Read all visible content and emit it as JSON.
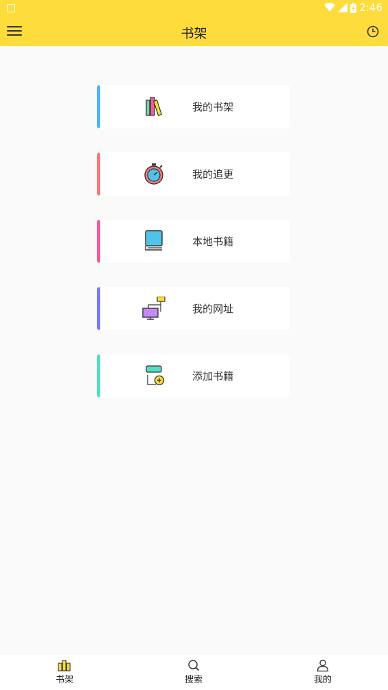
{
  "status_bar": {
    "time": "2:46"
  },
  "app_bar": {
    "title": "书架"
  },
  "menu_cards": [
    {
      "label": "我的书架",
      "icon": "bookshelf-icon",
      "color": "#4db6f0"
    },
    {
      "label": "我的追更",
      "icon": "stopwatch-icon",
      "color": "#f7787a"
    },
    {
      "label": "本地书籍",
      "icon": "local-book-icon",
      "color": "#f25c9a"
    },
    {
      "label": "我的网址",
      "icon": "web-network-icon",
      "color": "#7b79f0"
    },
    {
      "label": "添加书籍",
      "icon": "add-book-icon",
      "color": "#54dfc1"
    }
  ],
  "bottom_nav": [
    {
      "label": "书架",
      "icon": "bookshelf-icon",
      "active": true
    },
    {
      "label": "搜索",
      "icon": "search-icon",
      "active": false
    },
    {
      "label": "我的",
      "icon": "user-icon",
      "active": false
    }
  ],
  "colors": {
    "accent": "#fddc3b",
    "background": "#fafafa"
  }
}
